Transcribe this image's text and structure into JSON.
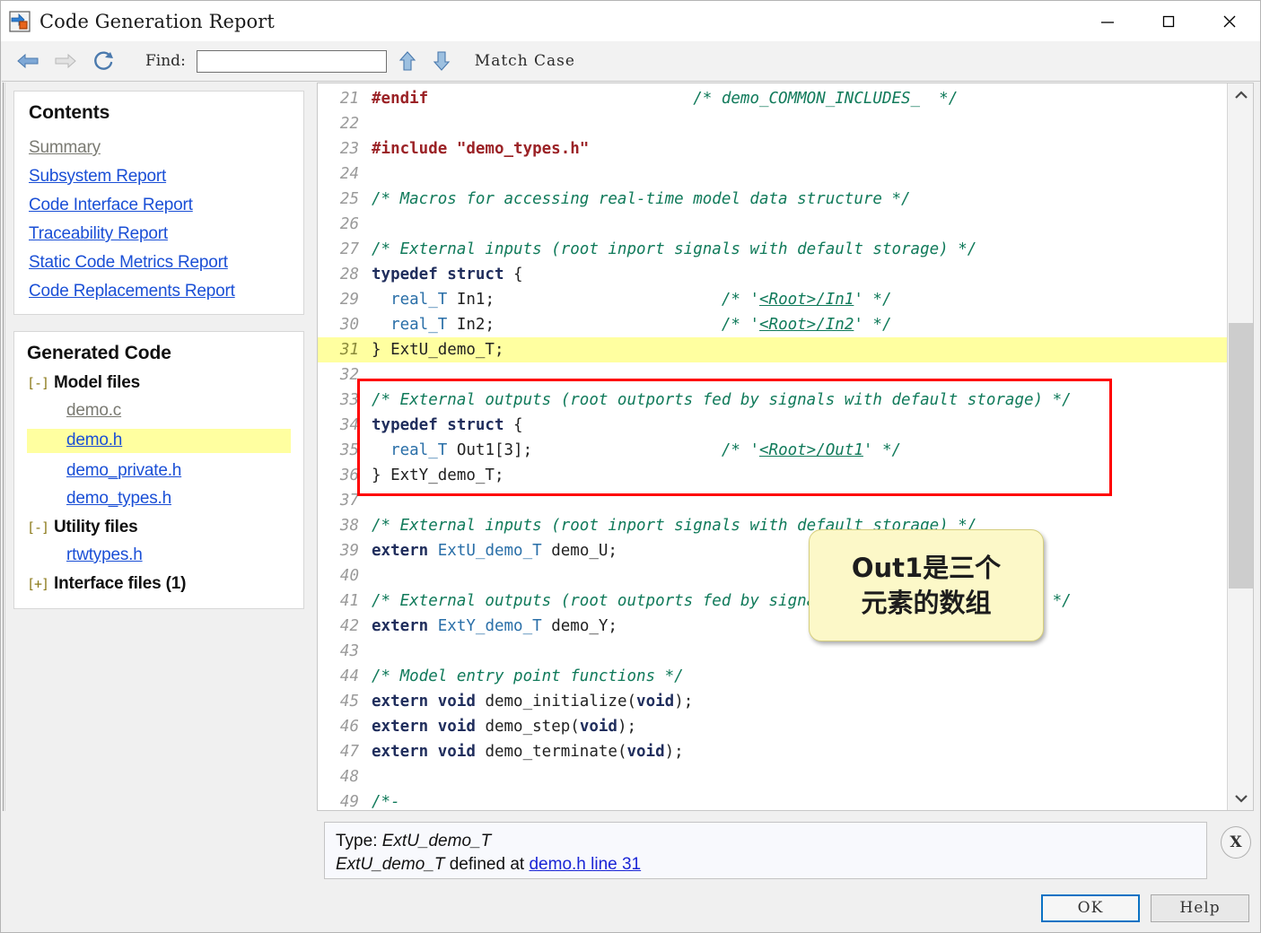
{
  "window": {
    "title": "Code Generation Report",
    "icon": "simulink-report-icon",
    "minimize_label": "—",
    "maximize_label": "□",
    "close_label": "✕"
  },
  "toolbar": {
    "back_icon": "back-arrow-icon",
    "forward_icon": "forward-arrow-icon",
    "refresh_icon": "refresh-icon",
    "find_label": "Find:",
    "find_value": "",
    "find_placeholder": "",
    "find_prev_icon": "up-arrow-icon",
    "find_next_icon": "down-arrow-icon",
    "match_case_label": "Match Case"
  },
  "sidebar": {
    "contents": {
      "heading": "Contents",
      "links": [
        {
          "label": "Summary",
          "state": "visited"
        },
        {
          "label": "Subsystem Report",
          "state": "link"
        },
        {
          "label": "Code Interface Report",
          "state": "link"
        },
        {
          "label": "Traceability Report",
          "state": "link"
        },
        {
          "label": "Static Code Metrics Report",
          "state": "link"
        },
        {
          "label": "Code Replacements Report",
          "state": "link"
        }
      ]
    },
    "generated_code": {
      "heading": "Generated Code",
      "groups": [
        {
          "toggle": "[-]",
          "label": "Model files",
          "files": [
            {
              "label": "demo.c",
              "state": "visited",
              "selected": false
            },
            {
              "label": "demo.h",
              "state": "link",
              "selected": true
            },
            {
              "label": "demo_private.h",
              "state": "link",
              "selected": false
            },
            {
              "label": "demo_types.h",
              "state": "link",
              "selected": false
            }
          ]
        },
        {
          "toggle": "[-]",
          "label": "Utility files",
          "files": [
            {
              "label": "rtwtypes.h",
              "state": "link",
              "selected": false
            }
          ]
        },
        {
          "toggle": "[+]",
          "label": "Interface files (1)",
          "files": []
        }
      ]
    }
  },
  "code": {
    "first_line": 21,
    "highlighted_lines": [
      31
    ],
    "lines": [
      {
        "n": 21,
        "tokens": [
          {
            "t": "pre",
            "v": "#endif"
          },
          {
            "t": "pln",
            "v": "                            "
          },
          {
            "t": "cmt",
            "v": "/* demo_COMMON_INCLUDES_  */"
          }
        ]
      },
      {
        "n": 22,
        "tokens": []
      },
      {
        "n": 23,
        "tokens": [
          {
            "t": "pre",
            "v": "#include "
          },
          {
            "t": "str",
            "v": "\"demo_types.h\""
          }
        ]
      },
      {
        "n": 24,
        "tokens": []
      },
      {
        "n": 25,
        "tokens": [
          {
            "t": "cmt",
            "v": "/* Macros for accessing real-time model data structure */"
          }
        ]
      },
      {
        "n": 26,
        "tokens": []
      },
      {
        "n": 27,
        "tokens": [
          {
            "t": "cmt",
            "v": "/* External inputs (root inport signals with default storage) */"
          }
        ]
      },
      {
        "n": 28,
        "tokens": [
          {
            "t": "kw",
            "v": "typedef struct"
          },
          {
            "t": "pln",
            "v": " {"
          }
        ]
      },
      {
        "n": 29,
        "tokens": [
          {
            "t": "pln",
            "v": "  "
          },
          {
            "t": "typ",
            "v": "real_T"
          },
          {
            "t": "pln",
            "v": " In1;                        "
          },
          {
            "t": "cmt",
            "v": "/* '"
          },
          {
            "t": "lnk",
            "v": "<Root>/In1"
          },
          {
            "t": "cmt",
            "v": "' */"
          }
        ]
      },
      {
        "n": 30,
        "tokens": [
          {
            "t": "pln",
            "v": "  "
          },
          {
            "t": "typ",
            "v": "real_T"
          },
          {
            "t": "pln",
            "v": " In2;                        "
          },
          {
            "t": "cmt",
            "v": "/* '"
          },
          {
            "t": "lnk",
            "v": "<Root>/In2"
          },
          {
            "t": "cmt",
            "v": "' */"
          }
        ]
      },
      {
        "n": 31,
        "tokens": [
          {
            "t": "pln",
            "v": "} ExtU_demo_T;"
          }
        ]
      },
      {
        "n": 32,
        "tokens": []
      },
      {
        "n": 33,
        "tokens": [
          {
            "t": "cmt",
            "v": "/* External outputs (root outports fed by signals with default storage) */"
          }
        ]
      },
      {
        "n": 34,
        "tokens": [
          {
            "t": "kw",
            "v": "typedef struct"
          },
          {
            "t": "pln",
            "v": " {"
          }
        ]
      },
      {
        "n": 35,
        "tokens": [
          {
            "t": "pln",
            "v": "  "
          },
          {
            "t": "typ",
            "v": "real_T"
          },
          {
            "t": "pln",
            "v": " Out1[3];                    "
          },
          {
            "t": "cmt",
            "v": "/* '"
          },
          {
            "t": "lnk",
            "v": "<Root>/Out1"
          },
          {
            "t": "cmt",
            "v": "' */"
          }
        ]
      },
      {
        "n": 36,
        "tokens": [
          {
            "t": "pln",
            "v": "} ExtY_demo_T;"
          }
        ]
      },
      {
        "n": 37,
        "tokens": []
      },
      {
        "n": 38,
        "tokens": [
          {
            "t": "cmt",
            "v": "/* External inputs (root inport signals with default storage) */"
          }
        ]
      },
      {
        "n": 39,
        "tokens": [
          {
            "t": "kw",
            "v": "extern"
          },
          {
            "t": "pln",
            "v": " "
          },
          {
            "t": "typ",
            "v": "ExtU_demo_T"
          },
          {
            "t": "pln",
            "v": " demo_U;"
          }
        ]
      },
      {
        "n": 40,
        "tokens": []
      },
      {
        "n": 41,
        "tokens": [
          {
            "t": "cmt",
            "v": "/* External outputs (root outports fed by signals with default storage) */"
          }
        ]
      },
      {
        "n": 42,
        "tokens": [
          {
            "t": "kw",
            "v": "extern"
          },
          {
            "t": "pln",
            "v": " "
          },
          {
            "t": "typ",
            "v": "ExtY_demo_T"
          },
          {
            "t": "pln",
            "v": " demo_Y;"
          }
        ]
      },
      {
        "n": 43,
        "tokens": []
      },
      {
        "n": 44,
        "tokens": [
          {
            "t": "cmt",
            "v": "/* Model entry point functions */"
          }
        ]
      },
      {
        "n": 45,
        "tokens": [
          {
            "t": "kw",
            "v": "extern void"
          },
          {
            "t": "pln",
            "v": " demo_initialize("
          },
          {
            "t": "kw",
            "v": "void"
          },
          {
            "t": "pln",
            "v": ");"
          }
        ]
      },
      {
        "n": 46,
        "tokens": [
          {
            "t": "kw",
            "v": "extern void"
          },
          {
            "t": "pln",
            "v": " demo_step("
          },
          {
            "t": "kw",
            "v": "void"
          },
          {
            "t": "pln",
            "v": ");"
          }
        ]
      },
      {
        "n": 47,
        "tokens": [
          {
            "t": "kw",
            "v": "extern void"
          },
          {
            "t": "pln",
            "v": " demo_terminate("
          },
          {
            "t": "kw",
            "v": "void"
          },
          {
            "t": "pln",
            "v": ");"
          }
        ]
      },
      {
        "n": 48,
        "tokens": []
      },
      {
        "n": 49,
        "tokens": [
          {
            "t": "cmt",
            "v": "/*-"
          }
        ]
      }
    ]
  },
  "annotation": {
    "red_box": {
      "covers_lines": "33-37",
      "color": "#ff0000"
    },
    "callout_text": "Out1是三个元素的数组",
    "callout_line1": "Out1是三个",
    "callout_line2": "元素的数组",
    "callout_bg": "#fcf8c8"
  },
  "type_info": {
    "line1_prefix": "Type: ",
    "line1_type": "ExtU_demo_T",
    "line2_type": "ExtU_demo_T",
    "line2_middle": " defined at ",
    "line2_link": "demo.h line 31",
    "close_label": "X"
  },
  "footer": {
    "ok_label": "OK",
    "help_label": "Help"
  },
  "scrollbar": {
    "up_icon": "chevron-up-icon",
    "down_icon": "chevron-down-icon"
  }
}
